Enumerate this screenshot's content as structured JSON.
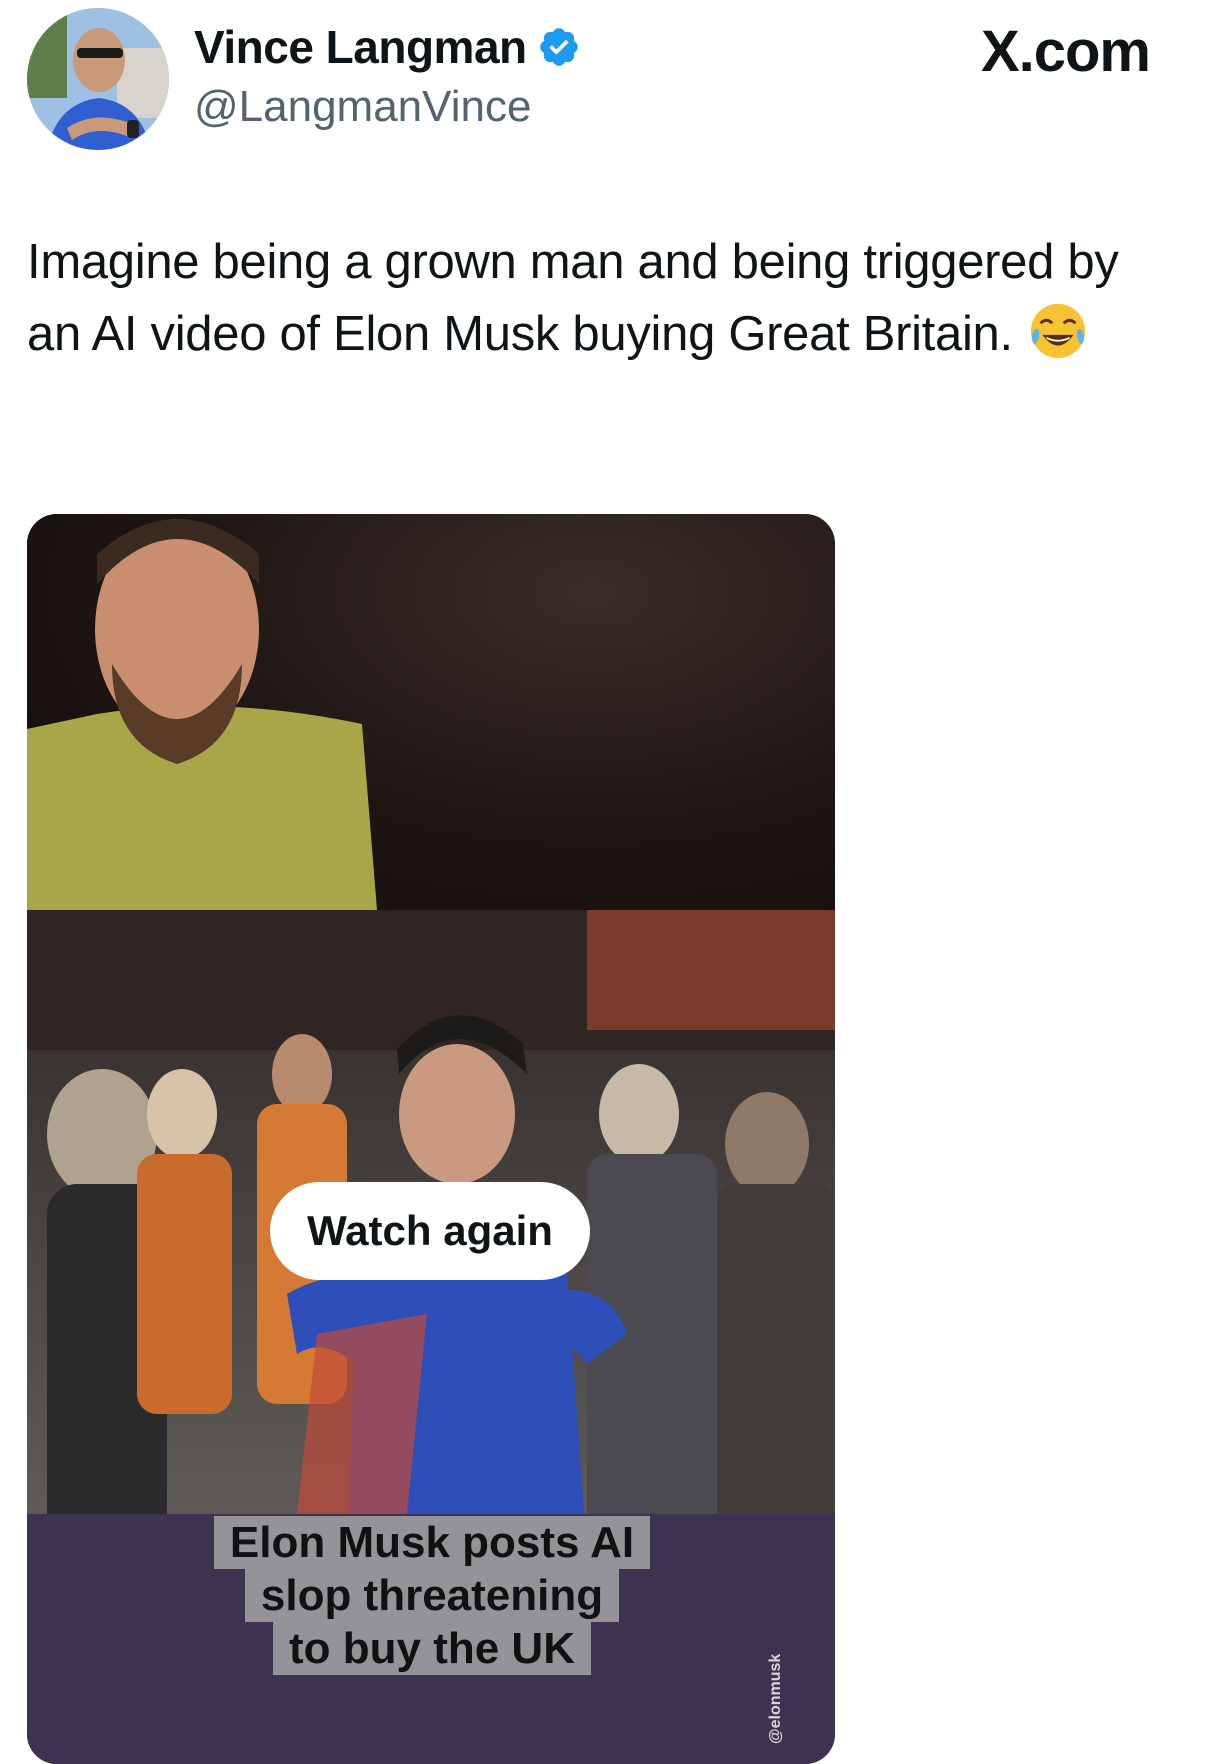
{
  "author": {
    "display_name": "Vince Langman",
    "handle": "@LangmanVince",
    "verified": true,
    "avatar_icon": "avatar-photo",
    "verified_icon": "verified-badge-icon",
    "verified_color": "#1d9bf0"
  },
  "site_label": "X.com",
  "tweet": {
    "text": "Imagine being a grown man and being triggered by an AI video of Elon Musk buying Great Britain.",
    "emoji_icon": "face-with-tears-of-joy-icon"
  },
  "media": {
    "watch_again_label": "Watch again",
    "watermark": "@elonmusk",
    "caption_lines": [
      "Elon Musk posts AI",
      "slop threatening",
      "to buy the UK"
    ]
  },
  "colors": {
    "text": "#0f1419",
    "secondary_text": "#536471",
    "background": "#ffffff"
  }
}
